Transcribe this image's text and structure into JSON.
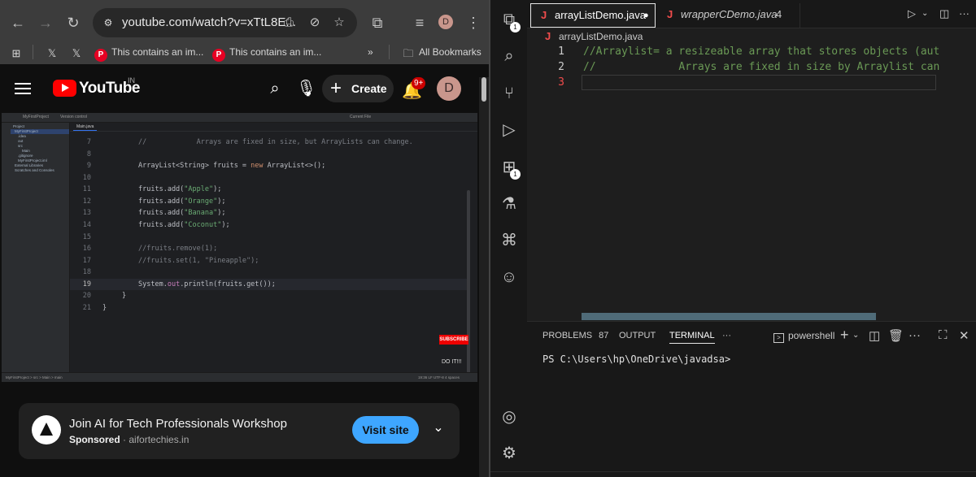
{
  "browser": {
    "url": "youtube.com/watch?v=xTtL8E...",
    "profile_initial": "D",
    "bookmarks": [
      {
        "label": "",
        "icon": "x-logo-icon"
      },
      {
        "label": "",
        "icon": "x-logo-icon"
      },
      {
        "label": "This contains an im...",
        "icon": "pinterest-icon"
      },
      {
        "label": "This contains an im...",
        "icon": "pinterest-icon"
      }
    ],
    "more_bookmarks": "»",
    "all_bookmarks": "All Bookmarks"
  },
  "youtube": {
    "logo_text": "YouTube",
    "country_code": "IN",
    "create_label": "Create",
    "notification_badge": "9+",
    "avatar_initial": "D"
  },
  "video": {
    "ide_project": "MyFirstProject",
    "ide_vcs": "Version control",
    "ide_run_config": "Current File",
    "ide_tab": "Main.java",
    "ide_tree": [
      "Project",
      "MyFirstProject",
      ".idea",
      "out",
      "src",
      "Main",
      ".gitignore",
      "MyFirstProject.iml",
      "External Libraries",
      "Scratches and Consoles"
    ],
    "status_path": "MyFirstProject > src > Main > main",
    "status_right": "19:36  LF  UTF-8  4 spaces",
    "line_numbers": [
      "7",
      "8",
      "9",
      "10",
      "11",
      "12",
      "13",
      "14",
      "15",
      "16",
      "17",
      "18",
      "19",
      "20",
      "21"
    ],
    "code": {
      "l7": "//            Arrays are fixed in size, but ArrayLists can change.",
      "l9a": "ArrayList<String> fruits = ",
      "l9kw": "new",
      "l9b": " ArrayList<>();",
      "l11a": "fruits.add(",
      "l11s": "\"Apple\"",
      "l12s": "\"Orange\"",
      "l13s": "\"Banana\"",
      "l14s": "\"Coconut\"",
      "close": ");",
      "l16": "//fruits.remove(1);",
      "l17": "//fruits.set(1, \"Pineapple\");",
      "l19a": "System.",
      "l19f": "out",
      "l19b": ".println(fruits.get());",
      "l20": "}",
      "l21": "}"
    },
    "subscribe_label": "SUBSCRIBE",
    "overlay_text": "DO IT!!!"
  },
  "ad": {
    "title": "Join AI for Tech Professionals Workshop",
    "sponsored": "Sponsored",
    "domain": "aifortechies.in",
    "separator": "·",
    "cta": "Visit site"
  },
  "vscode": {
    "explorer_badge": "1",
    "extensions_badge": "1",
    "tabs": [
      {
        "file": "arrayListDemo.java",
        "modified": true
      },
      {
        "file": "wrapperCDemo.java",
        "problems": "4"
      }
    ],
    "breadcrumb": "arrayListDemo.java",
    "file_icon": "J",
    "modified_dot": "●",
    "lines": [
      {
        "num": "1",
        "text": "//Arraylist= a resizeable array that stores objects (aut"
      },
      {
        "num": "2",
        "text": "//             Arrays are fixed in size by Arraylist can"
      },
      {
        "num": "3",
        "text": ""
      }
    ],
    "panel": {
      "problems_label": "PROBLEMS",
      "problems_count": "87",
      "output_label": "OUTPUT",
      "terminal_label": "TERMINAL",
      "more": "···",
      "shell": "powershell",
      "prompt": "PS C:\\Users\\hp\\OneDrive\\javadsa>"
    }
  }
}
